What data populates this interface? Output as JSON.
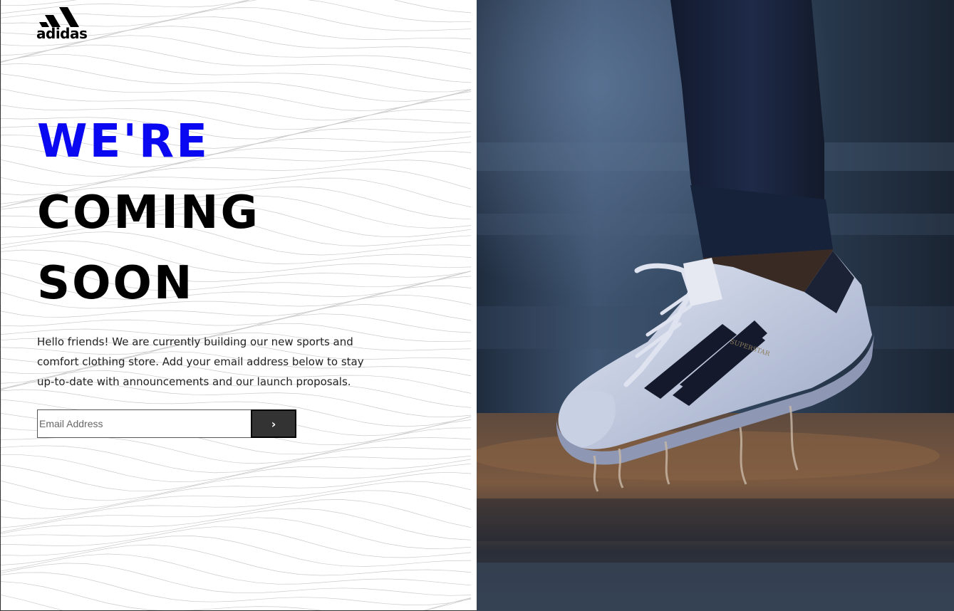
{
  "brand": {
    "logo_text": "adidas",
    "logo_name": "adidas-logo"
  },
  "hero": {
    "line1": "WE'RE",
    "line2": "COMING",
    "line3": "SOON",
    "accent_color": "#0a08f0"
  },
  "intro_text": "Hello friends! We are currently building our new sports and comfort clothing store. Add your email address below to stay up-to-date with announcements and our launch proposals.",
  "signup": {
    "email_placeholder": "Email Address",
    "email_value": "",
    "submit_label": "›"
  },
  "photo": {
    "icon": "sneaker-photo",
    "shoe_text": "SUPERSTAR"
  }
}
